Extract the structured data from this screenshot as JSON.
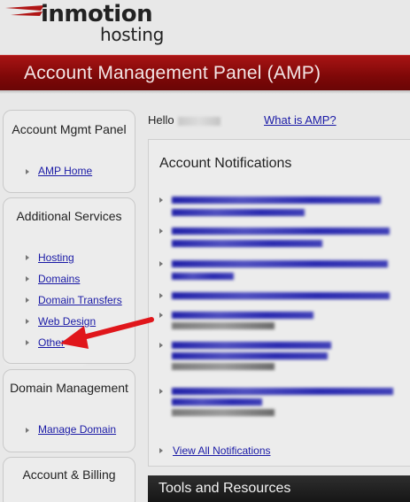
{
  "logo": {
    "main": "inmotion",
    "sub": "hosting"
  },
  "header": {
    "title": "Account Management Panel (AMP)"
  },
  "sidebar": {
    "account_mgmt": {
      "title": "Account Mgmt Panel",
      "links": [
        "AMP Home"
      ]
    },
    "additional_services": {
      "title": "Additional Services",
      "links": [
        "Hosting",
        "Domains",
        "Domain Transfers",
        "Web Design",
        "Other"
      ]
    },
    "domain_management": {
      "title": "Domain Management",
      "links": [
        "Manage Domain"
      ]
    },
    "billing": {
      "title": "Account & Billing"
    }
  },
  "main": {
    "hello_label": "Hello",
    "what_is_amp": "What is AMP?",
    "notifications": {
      "title": "Account Notifications",
      "view_all": "View All Notifications"
    },
    "tools": {
      "title": "Tools and Resources"
    }
  },
  "colors": {
    "header_red": "#8a0b0b",
    "link_blue": "#1a1aa6",
    "annotation_arrow": "#e0161b"
  }
}
